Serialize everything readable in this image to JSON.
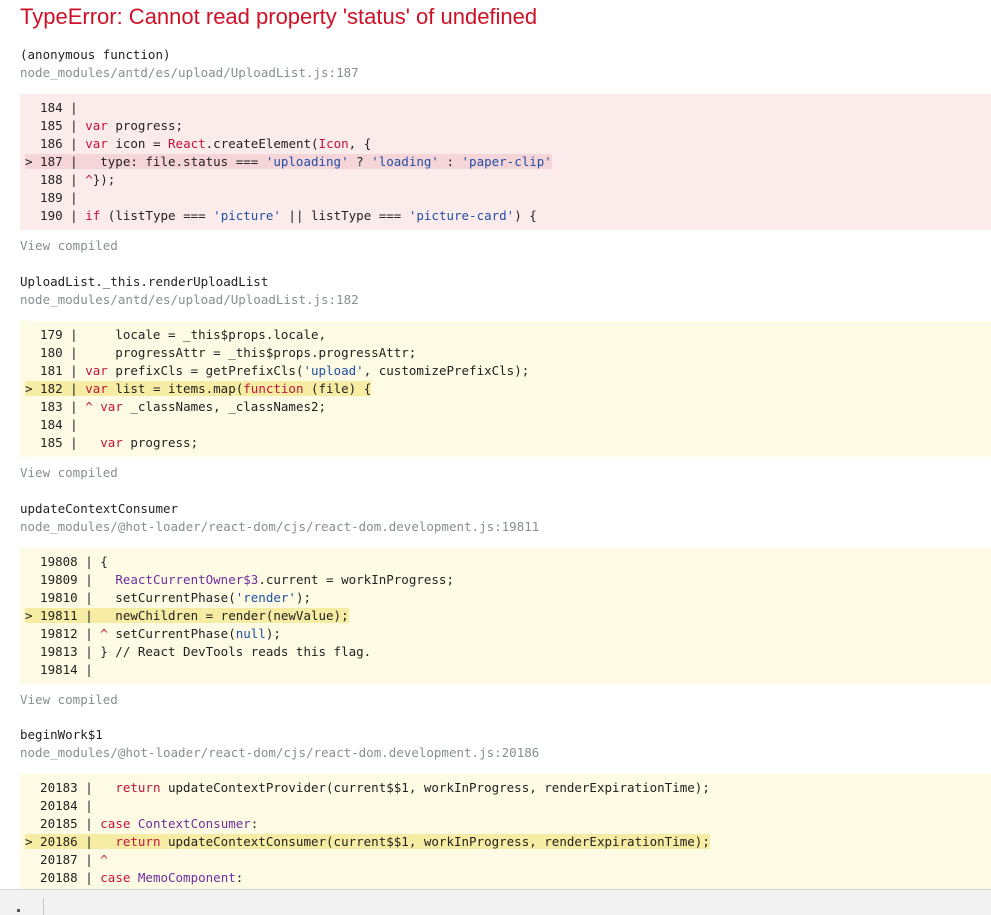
{
  "error": {
    "title": "TypeError: Cannot read property 'status' of undefined"
  },
  "view_compiled_label": "View compiled",
  "frames": [
    {
      "function": "(anonymous function)",
      "location": "node_modules/antd/es/upload/UploadList.js:187",
      "box": "err",
      "lines": [
        {
          "parts": [
            [
              "  184 | ",
              ""
            ]
          ]
        },
        {
          "parts": [
            [
              "  185 | ",
              ""
            ],
            [
              "var",
              "k"
            ],
            [
              " progress;",
              ""
            ]
          ]
        },
        {
          "parts": [
            [
              "  186 | ",
              ""
            ],
            [
              "var",
              "k"
            ],
            [
              " icon = ",
              ""
            ],
            [
              "React",
              "k"
            ],
            [
              ".createElement(",
              ""
            ],
            [
              "Icon",
              "k"
            ],
            [
              ", {",
              ""
            ]
          ]
        },
        {
          "hl": true,
          "parts": [
            [
              "> 187 |   type: file.status === ",
              ""
            ],
            [
              "'uploading'",
              "s"
            ],
            [
              " ? ",
              ""
            ],
            [
              "'loading'",
              "s"
            ],
            [
              " : ",
              ""
            ],
            [
              "'paper-clip'",
              "s"
            ]
          ]
        },
        {
          "parts": [
            [
              "  188 | ",
              ""
            ],
            [
              "^",
              "k"
            ],
            [
              "});",
              ""
            ]
          ]
        },
        {
          "parts": [
            [
              "  189 | ",
              ""
            ]
          ]
        },
        {
          "parts": [
            [
              "  190 | ",
              ""
            ],
            [
              "if",
              "k"
            ],
            [
              " (listType === ",
              ""
            ],
            [
              "'picture'",
              "s"
            ],
            [
              " || listType === ",
              ""
            ],
            [
              "'picture-card'",
              "s"
            ],
            [
              ") {",
              ""
            ]
          ]
        }
      ]
    },
    {
      "function": "UploadList._this.renderUploadList",
      "location": "node_modules/antd/es/upload/UploadList.js:182",
      "box": "warn",
      "lines": [
        {
          "parts": [
            [
              "  179 |     locale = _this$props.locale,",
              ""
            ]
          ]
        },
        {
          "parts": [
            [
              "  180 |     progressAttr = _this$props.progressAttr;",
              ""
            ]
          ]
        },
        {
          "parts": [
            [
              "  181 | ",
              ""
            ],
            [
              "var",
              "k"
            ],
            [
              " prefixCls = getPrefixCls(",
              ""
            ],
            [
              "'upload'",
              "s"
            ],
            [
              ", customizePrefixCls);",
              ""
            ]
          ]
        },
        {
          "hl": true,
          "parts": [
            [
              "> 182 | ",
              ""
            ],
            [
              "var",
              "k"
            ],
            [
              " list = items.map(",
              ""
            ],
            [
              "function",
              "k"
            ],
            [
              " (file) {",
              ""
            ]
          ]
        },
        {
          "parts": [
            [
              "  183 | ",
              ""
            ],
            [
              "^",
              "k"
            ],
            [
              " ",
              ""
            ],
            [
              "var",
              "k"
            ],
            [
              " _classNames, _classNames2;",
              ""
            ]
          ]
        },
        {
          "parts": [
            [
              "  184 | ",
              ""
            ]
          ]
        },
        {
          "parts": [
            [
              "  185 |   ",
              ""
            ],
            [
              "var",
              "k"
            ],
            [
              " progress;",
              ""
            ]
          ]
        }
      ]
    },
    {
      "function": "updateContextConsumer",
      "location": "node_modules/@hot-loader/react-dom/cjs/react-dom.development.js:19811",
      "box": "warn",
      "lines": [
        {
          "parts": [
            [
              "  19808 | {",
              ""
            ]
          ]
        },
        {
          "parts": [
            [
              "  19809 |   ",
              ""
            ],
            [
              "ReactCurrentOwner$3",
              "v"
            ],
            [
              ".current = workInProgress;",
              ""
            ]
          ]
        },
        {
          "parts": [
            [
              "  19810 |   setCurrentPhase(",
              ""
            ],
            [
              "'render'",
              "s"
            ],
            [
              ");",
              ""
            ]
          ]
        },
        {
          "hl": true,
          "parts": [
            [
              "> 19811 |   newChildren = render(newValue);",
              ""
            ]
          ]
        },
        {
          "parts": [
            [
              "  19812 | ",
              ""
            ],
            [
              "^",
              "k"
            ],
            [
              " setCurrentPhase(",
              ""
            ],
            [
              "null",
              "s"
            ],
            [
              ");",
              ""
            ]
          ]
        },
        {
          "parts": [
            [
              "  19813 | } // React DevTools reads this flag.",
              ""
            ]
          ]
        },
        {
          "parts": [
            [
              "  19814 | ",
              ""
            ]
          ]
        }
      ]
    },
    {
      "function": "beginWork$1",
      "location": "node_modules/@hot-loader/react-dom/cjs/react-dom.development.js:20186",
      "box": "warn",
      "lines": [
        {
          "parts": [
            [
              "  20183 |   ",
              ""
            ],
            [
              "return",
              "k"
            ],
            [
              " updateContextProvider(current$$1, workInProgress, renderExpirationTime);",
              ""
            ]
          ]
        },
        {
          "parts": [
            [
              "  20184 | ",
              ""
            ]
          ]
        },
        {
          "parts": [
            [
              "  20185 | ",
              ""
            ],
            [
              "case",
              "k"
            ],
            [
              " ",
              ""
            ],
            [
              "ContextConsumer",
              "v"
            ],
            [
              ":",
              ""
            ]
          ]
        },
        {
          "hl": true,
          "parts": [
            [
              "> 20186 |   ",
              ""
            ],
            [
              "return",
              "k"
            ],
            [
              " updateContextConsumer(current$$1, workInProgress, renderExpirationTime);",
              ""
            ]
          ]
        },
        {
          "parts": [
            [
              "  20187 | ",
              ""
            ],
            [
              "^",
              "k"
            ]
          ]
        },
        {
          "parts": [
            [
              "  20188 | ",
              ""
            ],
            [
              "case",
              "k"
            ],
            [
              " ",
              ""
            ],
            [
              "MemoComponent",
              "v"
            ],
            [
              ":",
              ""
            ]
          ]
        }
      ]
    }
  ]
}
